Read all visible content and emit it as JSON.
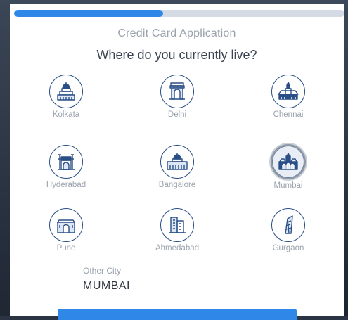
{
  "progress": {
    "fraction": 0.45
  },
  "header": {
    "app_title": "Credit Card Application",
    "question": "Where do you currently live?"
  },
  "cities": [
    {
      "label": "Kolkata",
      "icon": "kolkata-landmark-icon",
      "selected": false
    },
    {
      "label": "Delhi",
      "icon": "india-gate-icon",
      "selected": false
    },
    {
      "label": "Chennai",
      "icon": "chennai-landmark-icon",
      "selected": false
    },
    {
      "label": "Hyderabad",
      "icon": "charminar-icon",
      "selected": false
    },
    {
      "label": "Bangalore",
      "icon": "vidhana-soudha-icon",
      "selected": false
    },
    {
      "label": "Mumbai",
      "icon": "mumbai-landmark-icon",
      "selected": true
    },
    {
      "label": "Pune",
      "icon": "pune-landmark-icon",
      "selected": false
    },
    {
      "label": "Ahmedabad",
      "icon": "ahmedabad-building-icon",
      "selected": false
    },
    {
      "label": "Gurgaon",
      "icon": "gurgaon-tower-icon",
      "selected": false
    }
  ],
  "other_city": {
    "label": "Other City",
    "value": "MUMBAI"
  },
  "colors": {
    "accent": "#2f88e8",
    "icon_stroke": "#2a4f86",
    "label_gray": "#9aa2ad"
  }
}
